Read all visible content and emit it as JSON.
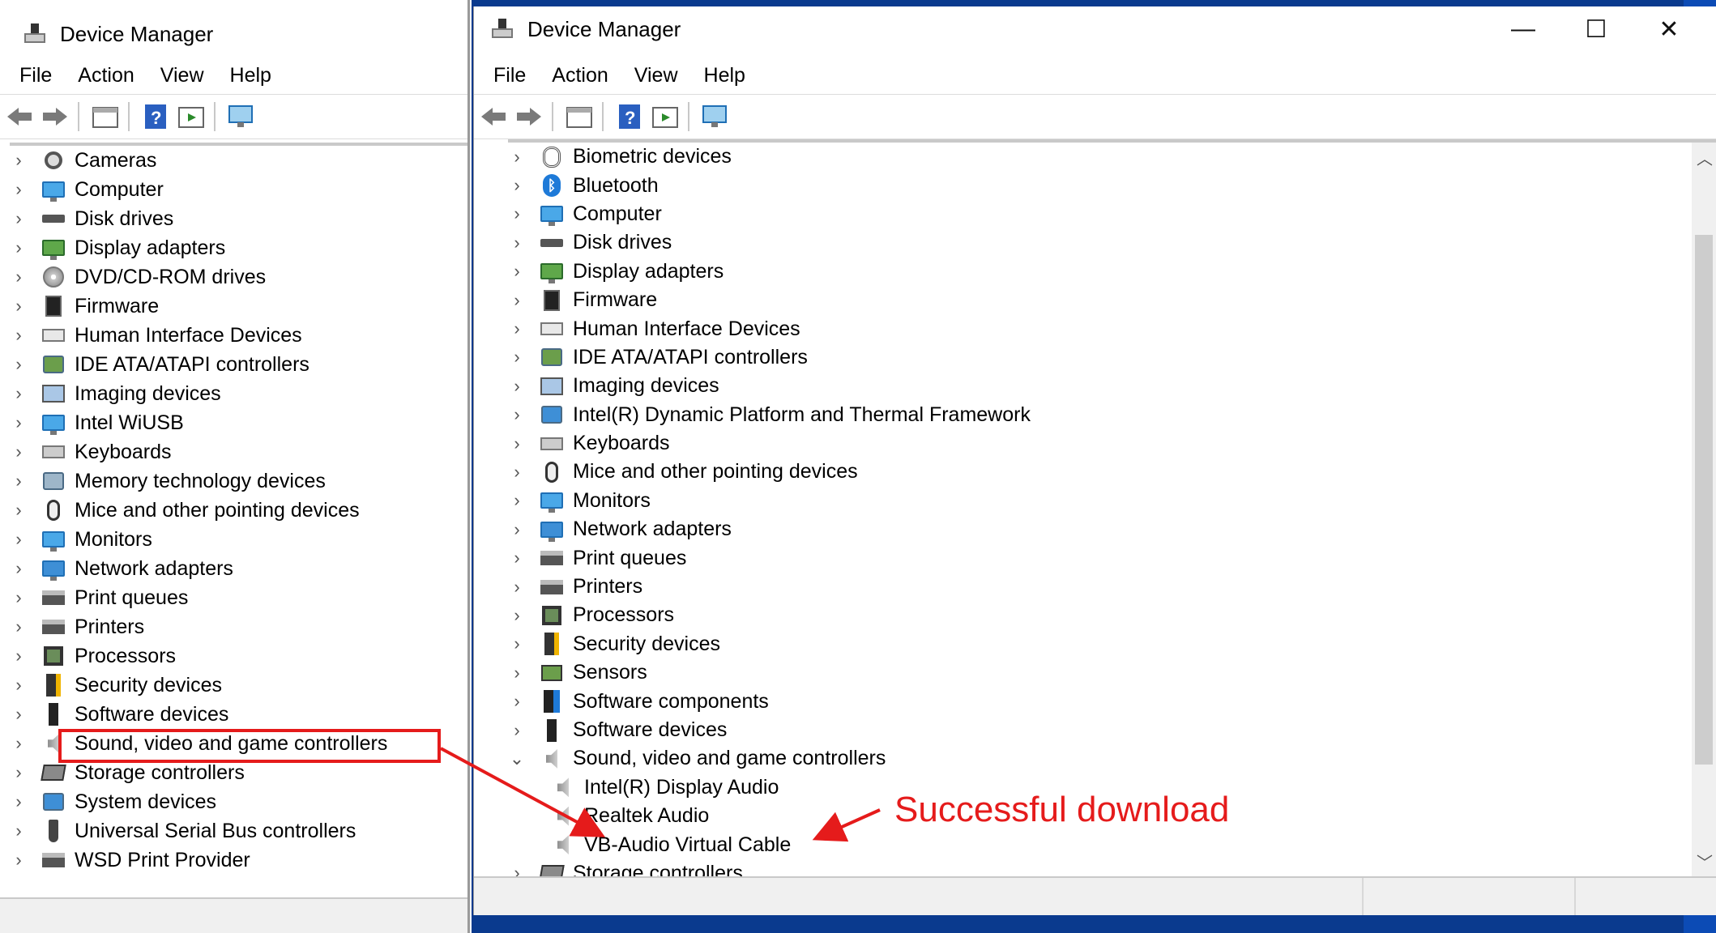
{
  "left_window": {
    "title": "Device Manager",
    "menu": [
      "File",
      "Action",
      "View",
      "Help"
    ],
    "tree": [
      {
        "label": "Cameras",
        "icon": "camera-icon"
      },
      {
        "label": "Computer",
        "icon": "monitor-icon"
      },
      {
        "label": "Disk drives",
        "icon": "disk-icon"
      },
      {
        "label": "Display adapters",
        "icon": "display-adapter-icon"
      },
      {
        "label": "DVD/CD-ROM drives",
        "icon": "dvd-icon"
      },
      {
        "label": "Firmware",
        "icon": "firmware-icon"
      },
      {
        "label": "Human Interface Devices",
        "icon": "hid-icon"
      },
      {
        "label": "IDE ATA/ATAPI controllers",
        "icon": "ide-controller-icon"
      },
      {
        "label": "Imaging devices",
        "icon": "imaging-icon"
      },
      {
        "label": "Intel WiUSB",
        "icon": "monitor-icon"
      },
      {
        "label": "Keyboards",
        "icon": "keyboard-icon"
      },
      {
        "label": "Memory technology devices",
        "icon": "memory-icon"
      },
      {
        "label": "Mice and other pointing devices",
        "icon": "mouse-icon"
      },
      {
        "label": "Monitors",
        "icon": "monitor-icon"
      },
      {
        "label": "Network adapters",
        "icon": "network-icon"
      },
      {
        "label": "Print queues",
        "icon": "printer-icon"
      },
      {
        "label": "Printers",
        "icon": "printer-icon"
      },
      {
        "label": "Processors",
        "icon": "processor-icon"
      },
      {
        "label": "Security devices",
        "icon": "security-icon"
      },
      {
        "label": "Software devices",
        "icon": "software-device-icon"
      },
      {
        "label": "Sound, video and game controllers",
        "icon": "speaker-icon"
      },
      {
        "label": "Storage controllers",
        "icon": "storage-icon"
      },
      {
        "label": "System devices",
        "icon": "system-icon"
      },
      {
        "label": "Universal Serial Bus controllers",
        "icon": "usb-icon"
      },
      {
        "label": "WSD Print Provider",
        "icon": "printer-icon"
      }
    ]
  },
  "right_window": {
    "title": "Device Manager",
    "menu": [
      "File",
      "Action",
      "View",
      "Help"
    ],
    "controls": {
      "minimize": "—",
      "maximize": "☐",
      "close": "✕"
    },
    "tree": [
      {
        "label": "Biometric devices",
        "icon": "fingerprint-icon",
        "expanded": false
      },
      {
        "label": "Bluetooth",
        "icon": "bluetooth-icon",
        "expanded": false
      },
      {
        "label": "Computer",
        "icon": "monitor-icon",
        "expanded": false
      },
      {
        "label": "Disk drives",
        "icon": "disk-icon",
        "expanded": false
      },
      {
        "label": "Display adapters",
        "icon": "display-adapter-icon",
        "expanded": false
      },
      {
        "label": "Firmware",
        "icon": "firmware-icon",
        "expanded": false
      },
      {
        "label": "Human Interface Devices",
        "icon": "hid-icon",
        "expanded": false
      },
      {
        "label": "IDE ATA/ATAPI controllers",
        "icon": "ide-controller-icon",
        "expanded": false
      },
      {
        "label": "Imaging devices",
        "icon": "imaging-icon",
        "expanded": false
      },
      {
        "label": "Intel(R) Dynamic Platform and Thermal Framework",
        "icon": "folder-icon",
        "expanded": false
      },
      {
        "label": "Keyboards",
        "icon": "keyboard-icon",
        "expanded": false
      },
      {
        "label": "Mice and other pointing devices",
        "icon": "mouse-icon",
        "expanded": false
      },
      {
        "label": "Monitors",
        "icon": "monitor-icon",
        "expanded": false
      },
      {
        "label": "Network adapters",
        "icon": "network-icon",
        "expanded": false
      },
      {
        "label": "Print queues",
        "icon": "printer-icon",
        "expanded": false
      },
      {
        "label": "Printers",
        "icon": "printer-icon",
        "expanded": false
      },
      {
        "label": "Processors",
        "icon": "processor-icon",
        "expanded": false
      },
      {
        "label": "Security devices",
        "icon": "security-icon",
        "expanded": false
      },
      {
        "label": "Sensors",
        "icon": "sensor-icon",
        "expanded": false
      },
      {
        "label": "Software components",
        "icon": "software-component-icon",
        "expanded": false
      },
      {
        "label": "Software devices",
        "icon": "software-device-icon",
        "expanded": false
      },
      {
        "label": "Sound, video and game controllers",
        "icon": "speaker-icon",
        "expanded": true
      },
      {
        "label": "Intel(R) Display Audio",
        "icon": "speaker-icon",
        "child": true
      },
      {
        "label": "Realtek Audio",
        "icon": "speaker-icon",
        "child": true
      },
      {
        "label": "VB-Audio Virtual Cable",
        "icon": "speaker-icon",
        "child": true
      },
      {
        "label": "Storage controllers",
        "icon": "storage-icon",
        "expanded": false
      }
    ]
  },
  "annotation": {
    "note": "Successful download",
    "color": "#e51b1b"
  }
}
